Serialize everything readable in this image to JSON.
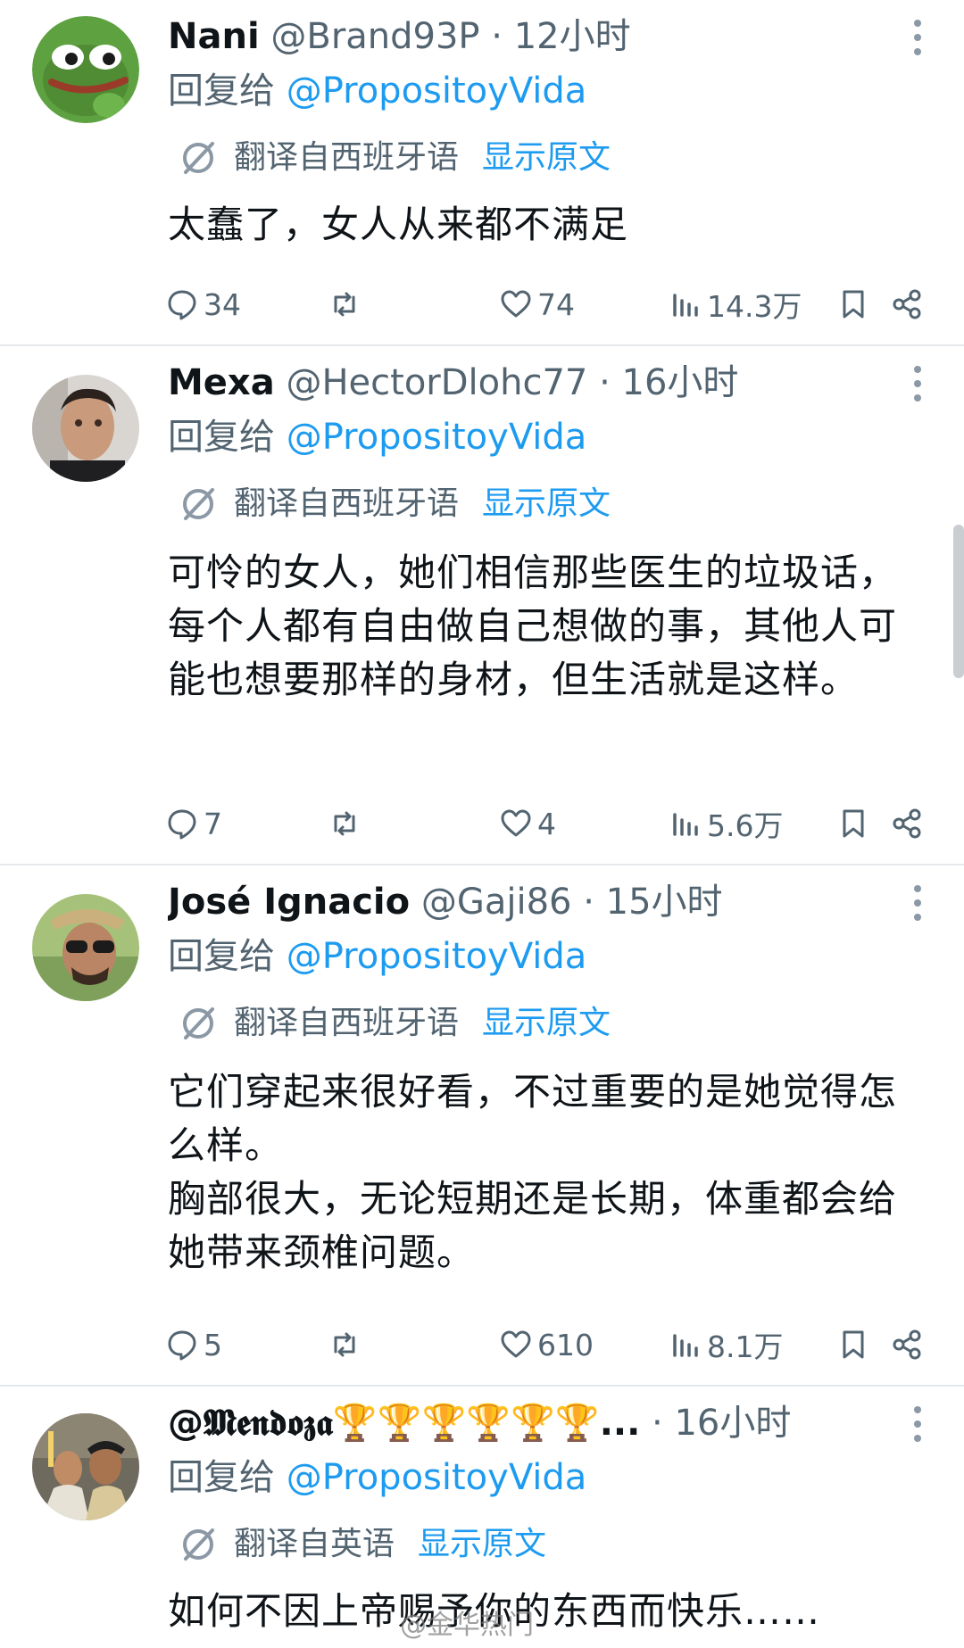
{
  "colors": {
    "accent": "#1d9bf0",
    "secondary_text": "#536471",
    "divider": "#e6e9ec"
  },
  "tweets": [
    {
      "name": "Nani",
      "handle": "@Brand93P",
      "sep": " · ",
      "time": "12小时",
      "reply_prefix": "回复给 ",
      "reply_to": "@PropositoyVida",
      "translate_label": "翻译自西班牙语",
      "show_original": "显示原文",
      "text": [
        "太蠢了，女人从来都不满足"
      ],
      "replies": "34",
      "likes": "74",
      "views": "14.3万",
      "avatar_icon": "pepe-frog-avatar"
    },
    {
      "name": "Mexa",
      "handle": "@HectorDlohc77",
      "sep": " · ",
      "time": "16小时",
      "reply_prefix": "回复给 ",
      "reply_to": "@PropositoyVida",
      "translate_label": "翻译自西班牙语",
      "show_original": "显示原文",
      "text": [
        "可怜的女人，她们相信那些医生的垃圾话，每个人都有自由做自己想做的事，其他人可能也想要那样的身材，但生活就是这样。"
      ],
      "replies": "7",
      "likes": "4",
      "views": "5.6万",
      "avatar_icon": "man-selfie-avatar"
    },
    {
      "name": "José Ignacio",
      "handle": "@Gaji86",
      "sep": " · ",
      "time": "15小时",
      "reply_prefix": "回复给 ",
      "reply_to": "@PropositoyVida",
      "translate_label": "翻译自西班牙语",
      "show_original": "显示原文",
      "text": [
        "它们穿起来很好看，不过重要的是她觉得怎么样。",
        "胸部很大，无论短期还是长期，体重都会给她带来颈椎问题。"
      ],
      "replies": "5",
      "likes": "610",
      "views": "8.1万",
      "avatar_icon": "man-sunglasses-avatar"
    },
    {
      "name": "@𝕸𝖊𝖓𝖉𝖔𝖟𝖆🏆🏆🏆🏆🏆🏆...",
      "handle": "",
      "sep": " · ",
      "time": "16小时",
      "reply_prefix": "回复给 ",
      "reply_to": "@PropositoyVida",
      "translate_label": "翻译自英语",
      "show_original": "显示原文",
      "text": [
        "如何不因上帝赐予你的东西而快乐……"
      ],
      "avatar_icon": "crowd-photo-avatar"
    }
  ],
  "watermark": "@金华热门"
}
